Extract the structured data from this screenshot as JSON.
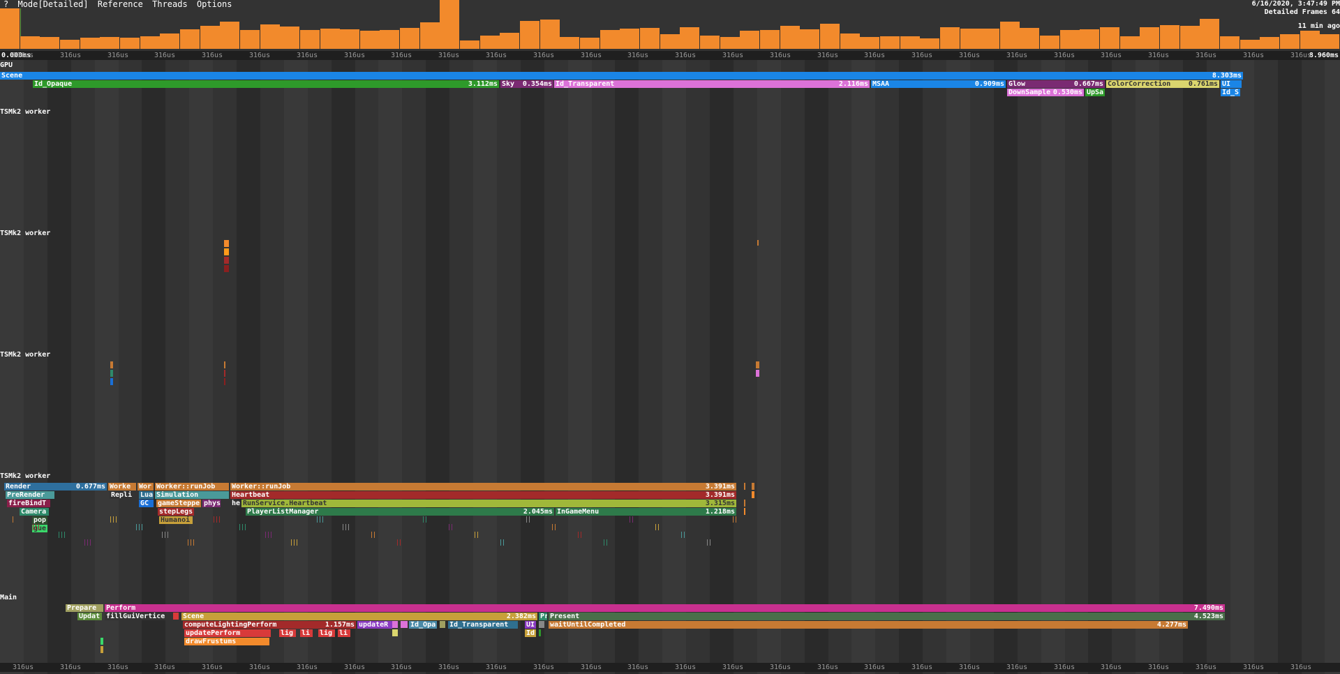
{
  "menu": [
    "?",
    "Mode[Detailed]",
    "Reference",
    "Threads",
    "Options"
  ],
  "info": {
    "datetime": "6/16/2020, 3:47:49 PM",
    "frames": "Detailed Frames 64",
    "ago": "11 min ago"
  },
  "ruler": {
    "start": "0.000ms",
    "end": "8.960ms",
    "tick": "316us"
  },
  "threads": {
    "gpu": "GPU",
    "w1": "TSMk2 worker",
    "w2": "TSMk2 worker",
    "w3": "TSMk2 worker",
    "w4": "TSMk2 worker",
    "main": "Main"
  },
  "gpu": {
    "scene": {
      "name": "Scene",
      "time": "8.303ms"
    },
    "id_opaque": {
      "name": "Id_Opaque",
      "time": "3.112ms"
    },
    "sky": {
      "name": "Sky",
      "time": "0.354ms"
    },
    "id_transparent": {
      "name": "Id_Transparent",
      "time": "2.116ms"
    },
    "msaa": {
      "name": "MSAA",
      "time": "0.909ms"
    },
    "glow": {
      "name": "Glow",
      "time": "0.667ms"
    },
    "colorcorrection": {
      "name": "ColorCorrection",
      "time": "0.761ms"
    },
    "ui": {
      "name": "UI",
      "time": ""
    },
    "downsample": {
      "name": "DownSample",
      "time": "0.530ms"
    },
    "upsa": {
      "name": "UpSa",
      "time": ""
    },
    "id_s": {
      "name": "Id_S",
      "time": ""
    }
  },
  "w4": {
    "render": {
      "name": "Render",
      "time": "0.677ms"
    },
    "prerender": {
      "name": "PreRender",
      "time": ""
    },
    "firebind": {
      "name": "fireBindT",
      "time": ""
    },
    "camera": {
      "name": "Camera",
      "time": ""
    },
    "pop": {
      "name": "pop",
      "time": ""
    },
    "gu": {
      "name": "gue",
      "time": ""
    },
    "worke": {
      "name": "Worke",
      "time": ""
    },
    "wor": {
      "name": "Wor",
      "time": ""
    },
    "wrj1": {
      "name": "Worker::runJob",
      "time": ""
    },
    "wrj2": {
      "name": "Worker::runJob",
      "time": "3.391ms"
    },
    "repli": {
      "name": "Repli",
      "time": ""
    },
    "lua": {
      "name": "Lua",
      "time": ""
    },
    "simulation": {
      "name": "Simulation",
      "time": ""
    },
    "heartbeat": {
      "name": "Heartbeat",
      "time": "3.391ms"
    },
    "gc": {
      "name": "GC",
      "time": ""
    },
    "gamestepper": {
      "name": "gameSteppe",
      "time": ""
    },
    "phys": {
      "name": "phys",
      "time": ""
    },
    "he": {
      "name": "he",
      "time": ""
    },
    "rsh": {
      "name": "RunService.Heartbeat",
      "time": "3.315ms"
    },
    "steplegs": {
      "name": "stepLegs",
      "time": ""
    },
    "plm": {
      "name": "PlayerListManager",
      "time": "2.045ms"
    },
    "ingamemenu": {
      "name": "InGameMenu",
      "time": "1.218ms"
    },
    "humanoi": {
      "name": "Humanoi",
      "time": ""
    }
  },
  "main": {
    "prepare": {
      "name": "Prepare",
      "time": ""
    },
    "perform": {
      "name": "Perform",
      "time": "7.490ms"
    },
    "updat": {
      "name": "Updat",
      "time": ""
    },
    "fillgui": {
      "name": "fillGuiVertice",
      "time": ""
    },
    "scene": {
      "name": "Scene",
      "time": "2.382ms"
    },
    "pr": {
      "name": "Pr",
      "time": ""
    },
    "present": {
      "name": "Present",
      "time": "4.523ms"
    },
    "clp": {
      "name": "computeLightingPerform",
      "time": "1.157ms"
    },
    "updater": {
      "name": "updateR",
      "time": ""
    },
    "idopa": {
      "name": "Id_Opa",
      "time": ""
    },
    "idtrans": {
      "name": "Id_Transparent",
      "time": ""
    },
    "ui": {
      "name": "UI",
      "time": ""
    },
    "wuc": {
      "name": "waitUntilCompleted",
      "time": "4.277ms"
    },
    "updperf": {
      "name": "updatePerform",
      "time": ""
    },
    "lig1": {
      "name": "lig",
      "time": ""
    },
    "li1": {
      "name": "li",
      "time": ""
    },
    "lig2": {
      "name": "lig",
      "time": ""
    },
    "li2": {
      "name": "li",
      "time": ""
    },
    "id": {
      "name": "Id",
      "time": ""
    },
    "drawfrustum": {
      "name": "drawFrustums",
      "time": ""
    }
  }
}
